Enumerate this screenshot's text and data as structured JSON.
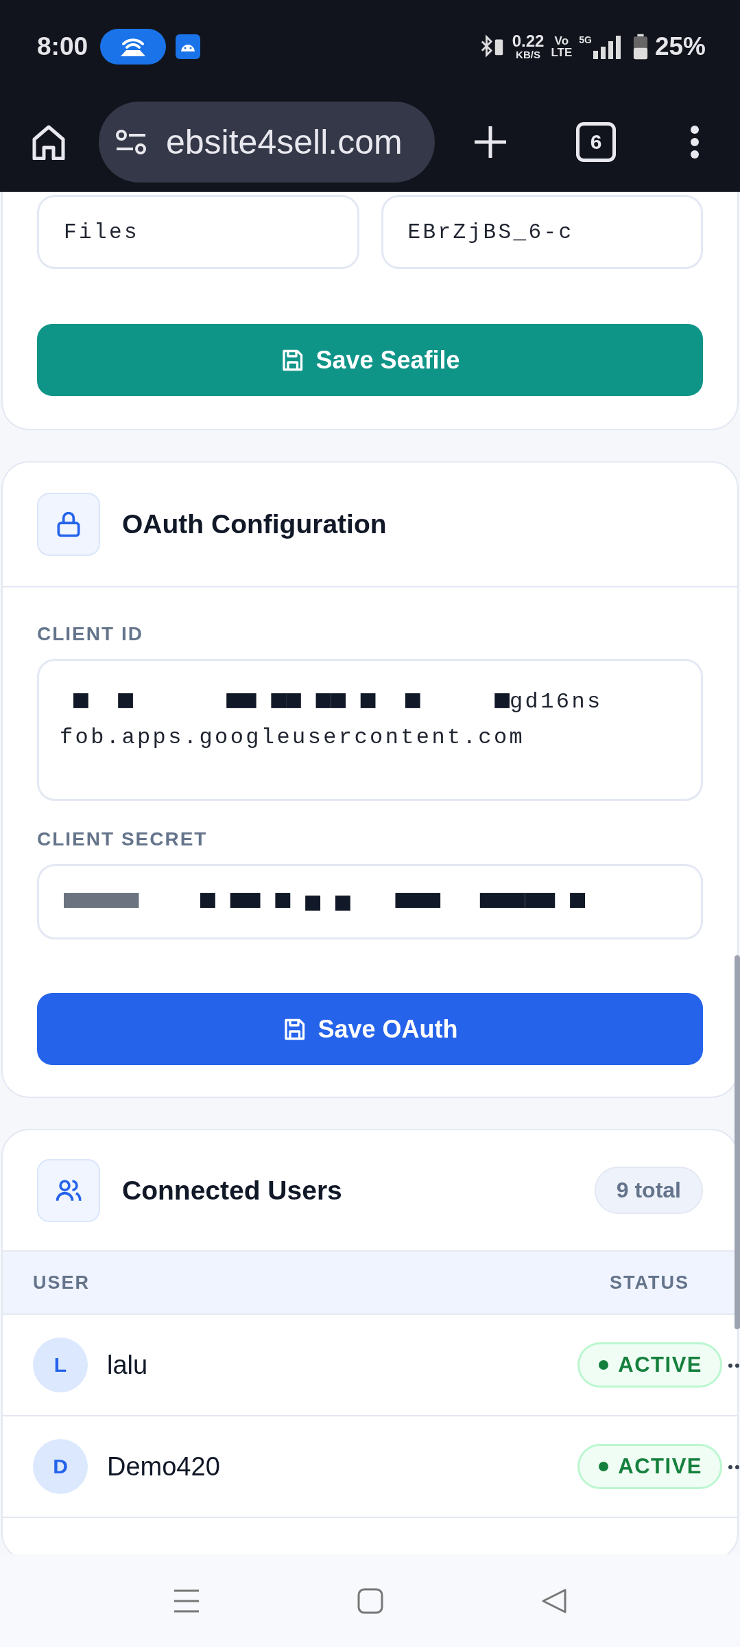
{
  "status_bar": {
    "time": "8:00",
    "net_speed": "0.22",
    "net_unit": "KB/S",
    "volte_top": "Vo",
    "volte_bottom": "LTE",
    "network": "5G",
    "battery": "25%"
  },
  "browser": {
    "url": "ebsite4sell.com",
    "tab_count": "6"
  },
  "seafile": {
    "fields": [
      {
        "value": "Files"
      },
      {
        "value": "EBrZjBS_6-c"
      }
    ],
    "save_button": "Save Seafile"
  },
  "oauth": {
    "title": "OAuth Configuration",
    "client_id": {
      "label": "CLIENT ID",
      "redacted": true,
      "lines": [
        "gd16ns",
        "fob.apps.googleusercontent.com"
      ]
    },
    "client_secret": {
      "label": "CLIENT SECRET",
      "redacted": true
    },
    "save_button": "Save OAuth"
  },
  "users": {
    "title": "Connected Users",
    "total": "9 total",
    "columns": [
      "USER",
      "STATUS"
    ],
    "rows": [
      {
        "initial": "L",
        "name": "lalu",
        "status": "ACTIVE",
        "active": true
      },
      {
        "initial": "D",
        "name": "Demo420",
        "status": "ACTIVE",
        "active": true
      }
    ]
  }
}
